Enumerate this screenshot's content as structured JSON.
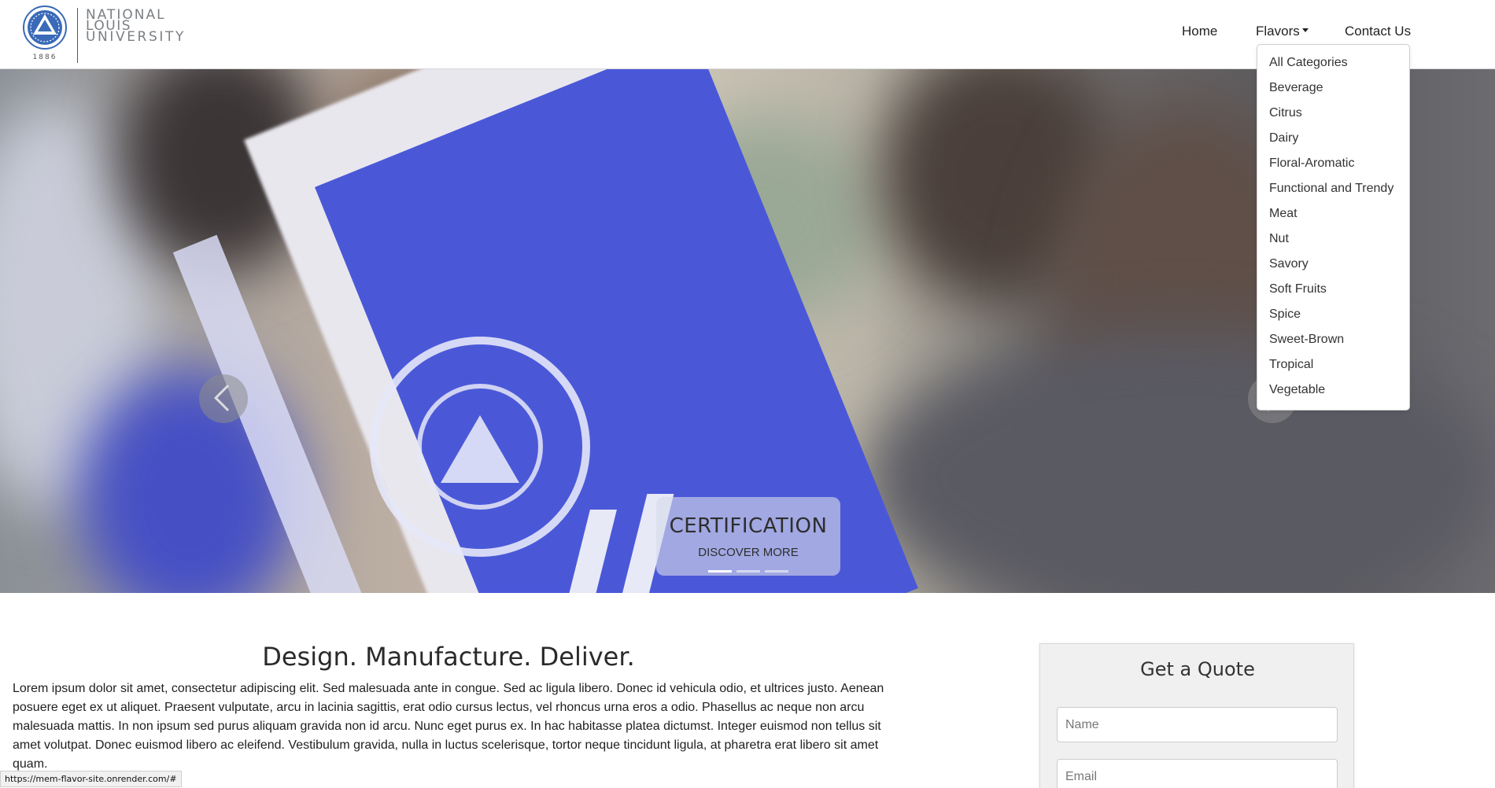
{
  "brand": {
    "name_lines": [
      "NATIONAL",
      "LOUIS",
      "UNIVERSITY"
    ],
    "year": "1886",
    "icon": "university-seal-icon",
    "accent_color": "#3a6ab8"
  },
  "nav": {
    "home": "Home",
    "flavors": "Flavors",
    "contact": "Contact Us"
  },
  "flavors_menu": {
    "items": [
      "All Categories",
      "Beverage",
      "Citrus",
      "Dairy",
      "Floral-Aromatic",
      "Functional and Trendy",
      "Meat",
      "Nut",
      "Savory",
      "Soft Fruits",
      "Spice",
      "Sweet-Brown",
      "Tropical",
      "Vegetable"
    ]
  },
  "hero": {
    "caption_title": "CERTIFICATION",
    "caption_link": "DISCOVER MORE",
    "slide_count": 3,
    "active_slide": 1,
    "prev_icon": "chevron-left-icon",
    "next_icon": "chevron-right-icon"
  },
  "main": {
    "heading": "Design. Manufacture. Deliver.",
    "body": "Lorem ipsum dolor sit amet, consectetur adipiscing elit. Sed malesuada ante in congue. Sed ac ligula libero. Donec id vehicula odio, et ultrices justo. Aenean posuere eget ex ut aliquet. Praesent vulputate, arcu in lacinia sagittis, erat odio cursus lectus, vel rhoncus urna eros a odio. Phasellus ac neque non arcu malesuada mattis. In non ipsum sed purus aliquam gravida non id arcu. Nunc eget purus ex. In hac habitasse platea dictumst. Integer euismod non tellus sit amet volutpat. Donec euismod libero ac eleifend. Vestibulum gravida, nulla in luctus scelerisque, tortor neque tincidunt ligula, at pharetra erat libero sit amet quam."
  },
  "quote": {
    "title": "Get a Quote",
    "name_placeholder": "Name",
    "email_placeholder": "Email"
  },
  "status_bar": {
    "url": "https://mem-flavor-site.onrender.com/#"
  }
}
